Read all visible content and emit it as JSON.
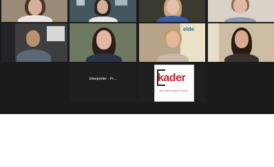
{
  "meeting": {
    "tiles": [
      {
        "id": "participant-1",
        "name": ""
      },
      {
        "id": "participant-2",
        "name": ""
      },
      {
        "id": "participant-3",
        "name": ""
      },
      {
        "id": "participant-4",
        "name": ""
      },
      {
        "id": "participant-5",
        "name": ""
      },
      {
        "id": "participant-6",
        "name": ""
      },
      {
        "id": "participant-7",
        "name": ""
      },
      {
        "id": "participant-8",
        "name": ""
      },
      {
        "id": "interpreter",
        "name": ""
      },
      {
        "id": "kader-logo",
        "name": ""
      }
    ],
    "interpreter_label": "Interpreter - Fr...",
    "banner_text": "elde",
    "logo": {
      "brand": "kader",
      "subtitle": "Kadın Adayları Destekleme Derneği"
    }
  },
  "colors": {
    "background": "#1b1b1b",
    "page": "#ffffff",
    "brand_red": "#c4262e"
  }
}
